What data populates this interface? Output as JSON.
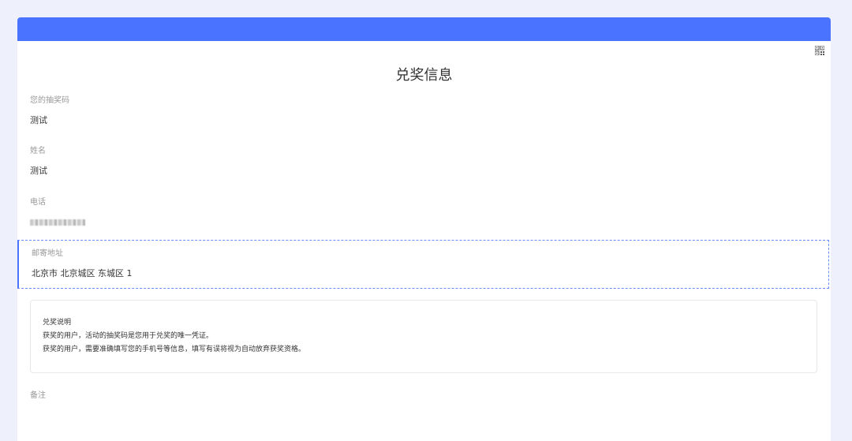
{
  "page": {
    "title": "兑奖信息",
    "qr_icon": "qr-code-icon",
    "accent_color": "#4a74ff"
  },
  "fields": {
    "lottery_code": {
      "label": "您的抽奖码",
      "value": "测试"
    },
    "name": {
      "label": "姓名",
      "value": "测试"
    },
    "phone": {
      "label": "电话",
      "value": ""
    },
    "address": {
      "label": "邮寄地址",
      "value": "北京市 北京城区 东城区 1"
    },
    "remark": {
      "label": "备注"
    }
  },
  "notice": {
    "title": "兑奖说明",
    "lines": [
      "获奖的用户，活动的抽奖码是您用于兑奖的唯一凭证。",
      "获奖的用户，需要准确填写您的手机号等信息，填写有误将视为自动放弃获奖资格。"
    ]
  }
}
